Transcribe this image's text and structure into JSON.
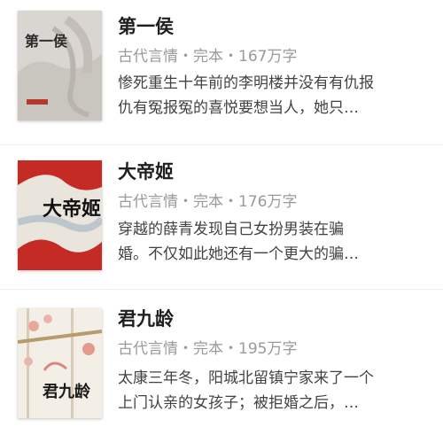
{
  "books": [
    {
      "title": "第一侯",
      "meta": "古代言情・完本・167万字",
      "synopsis_line1": "惨死重生十年前的李明楼并没有有仇报",
      "synopsis_line2": "仇有冤报冤的喜悦要想当人，她只…",
      "cover_text": "第一侯",
      "cover_colors": {
        "bg": "#d9d6d2",
        "ink": "#2a2a2a",
        "accent": "#b23a2e"
      }
    },
    {
      "title": "大帝姬",
      "meta": "古代言情・完本・176万字",
      "synopsis_line1": "穿越的薛青发现自己女扮男装在骗",
      "synopsis_line2": "婚。不仅如此她还有一个更大的骗…",
      "cover_text": "大帝姬",
      "cover_colors": {
        "bg": "#e9e4dc",
        "ink": "#111111",
        "accent": "#c42b24"
      }
    },
    {
      "title": "君九龄",
      "meta": "古代言情・完本・195万字",
      "synopsis_line1": "太康三年冬，阳城北留镇宁家来了一个",
      "synopsis_line2": "上门认亲的女孩子；被拒婚之后，…",
      "cover_text": "君九龄",
      "cover_colors": {
        "bg": "#f4efe6",
        "ink": "#1a1a1a",
        "accent": "#d9887a"
      }
    }
  ]
}
